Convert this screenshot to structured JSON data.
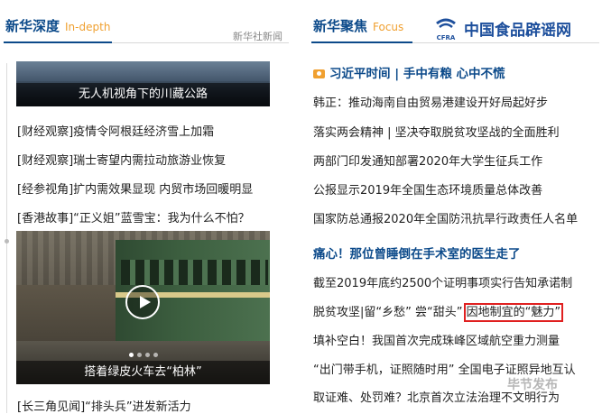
{
  "left_section": {
    "title": "新华深度",
    "title_en": "In-depth",
    "more_link": "新华社新闻",
    "photo1_caption": "无人机视角下的川藏公路",
    "news": [
      "[财经观察]疫情令阿根廷经济雪上加霜",
      "[财经观察]瑞士寄望内需拉动旅游业恢复",
      "[经参视角]扩内需效果显现  内贸市场回暖明显",
      "[香港故事]“正义姐”蓝雪宝：我为什么不怕？"
    ],
    "photo2_caption": "搭着绿皮火车去“柏林”",
    "news_after": "[长三角见闻]“排头兵”进发新活力"
  },
  "right_section": {
    "title": "新华聚焦",
    "title_en": "Focus",
    "logo_text": "中国食品辟谣网",
    "logo_abbr": "CFRA",
    "headline1": "习近平时间 | 手中有粮  心中不慌",
    "news1": [
      "韩正：推动海南自由贸易港建设开好局起好步",
      "落实两会精神 | 坚决夺取脱贫攻坚战的全面胜利",
      "两部门印发通知部署2020年大学生征兵工作",
      "公报显示2019年全国生态环境质量总体改善",
      "国家防总通报2020年全国防汛抗旱行政责任人名单"
    ],
    "headline2": "痛心！那位曾睡倒在手术室的医生走了",
    "news2_line1": "截至2019年底约2500个证明事项实行告知承诺制",
    "news2_line2_a": "脱贫攻坚|留“乡愁” 尝“甜头”",
    "news2_line2_b": "因地制宜的“魅力”",
    "news2": [
      "填补空白！我国首次完成珠峰区域航空重力测量",
      "“出门带手机，证照随时用” 全国电子证照异地互认",
      "取证难、处罚难？北京首次立法治理不文明行为"
    ]
  },
  "watermark": "毕节发布"
}
